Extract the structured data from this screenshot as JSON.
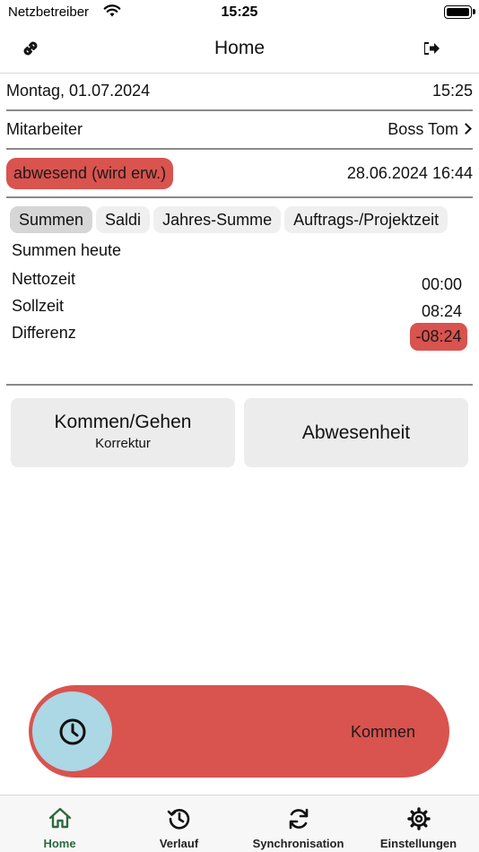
{
  "status_bar": {
    "carrier": "Netzbetreiber",
    "time": "15:25"
  },
  "header": {
    "title": "Home",
    "left_icon": "link-icon",
    "right_icon": "logout-icon"
  },
  "info": {
    "date": "Montag, 01.07.2024",
    "time": "15:25",
    "employee_label": "Mitarbeiter",
    "employee_name": "Boss Tom",
    "status": "abwesend (wird erw.)",
    "status_timestamp": "28.06.2024 16:44"
  },
  "tabs": [
    {
      "label": "Summen",
      "active": true
    },
    {
      "label": "Saldi",
      "active": false
    },
    {
      "label": "Jahres-Summe",
      "active": false
    },
    {
      "label": "Auftrags-/Projektzeit",
      "active": false
    }
  ],
  "summary": {
    "heading": "Summen heute",
    "rows": [
      {
        "label": "Nettozeit",
        "value": "00:00"
      },
      {
        "label": "Sollzeit",
        "value": "08:24"
      },
      {
        "label": "Differenz",
        "value": "-08:24"
      }
    ]
  },
  "actions": {
    "come_go": "Kommen/Gehen",
    "come_go_sub": "Korrektur",
    "absence": "Abwesenheit"
  },
  "slider": {
    "label": "Kommen",
    "icon": "clock-icon"
  },
  "tabbar": [
    {
      "label": "Home",
      "icon": "home-icon",
      "active": true
    },
    {
      "label": "Verlauf",
      "icon": "history-icon",
      "active": false
    },
    {
      "label": "Synchronisation",
      "icon": "sync-icon",
      "active": false
    },
    {
      "label": "Einstellungen",
      "icon": "gear-icon",
      "active": false
    }
  ],
  "colors": {
    "accent_red": "#d9534f",
    "knob_blue": "#acd7e4",
    "active_green": "#2d6a3e"
  }
}
